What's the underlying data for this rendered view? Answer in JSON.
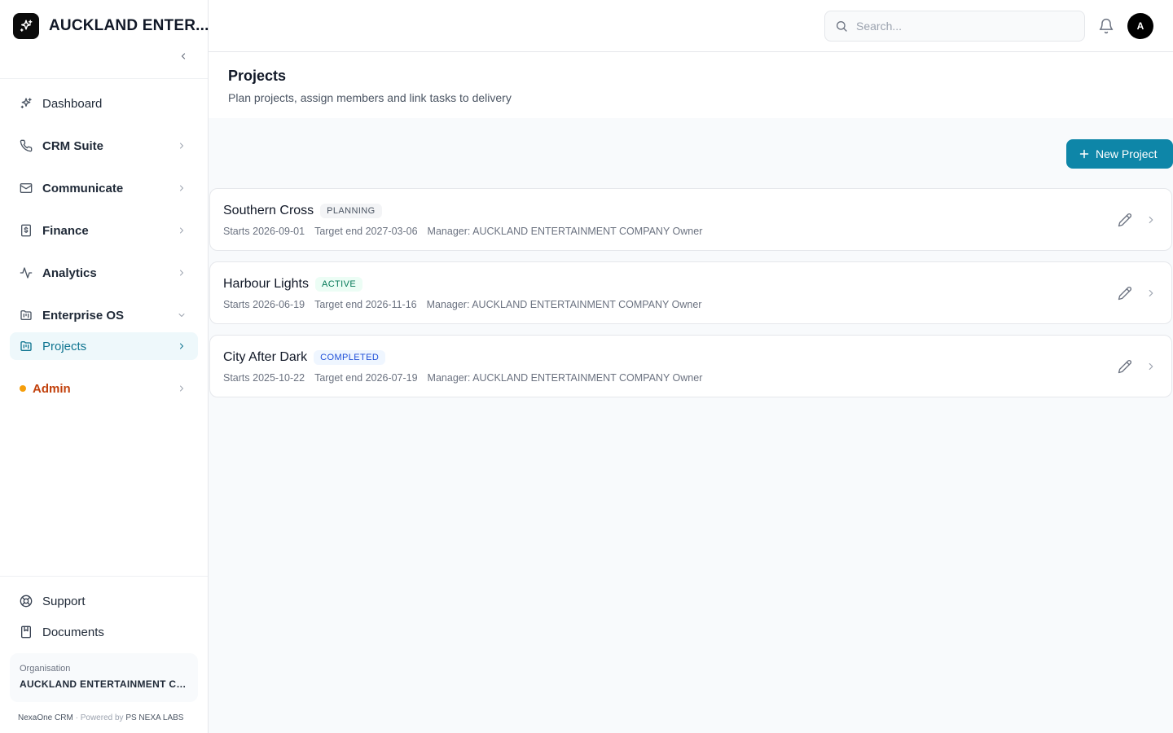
{
  "brand": {
    "name": "AUCKLAND ENTER..."
  },
  "sidebar": {
    "items": [
      {
        "label": "Dashboard",
        "icon": "sparkles-icon"
      },
      {
        "label": "CRM Suite",
        "icon": "phone-icon"
      },
      {
        "label": "Communicate",
        "icon": "mail-icon"
      },
      {
        "label": "Finance",
        "icon": "receipt-icon"
      },
      {
        "label": "Analytics",
        "icon": "activity-icon"
      },
      {
        "label": "Enterprise OS",
        "icon": "kanban-icon"
      },
      {
        "label": "Projects",
        "icon": "folder-kanban-icon"
      },
      {
        "label": "Admin",
        "icon": "status-dot"
      }
    ],
    "footer_items": [
      {
        "label": "Support",
        "icon": "life-buoy-icon"
      },
      {
        "label": "Documents",
        "icon": "book-icon"
      }
    ],
    "org": {
      "label": "Organisation",
      "name": "AUCKLAND ENTERTAINMENT CO..."
    },
    "powered": {
      "product": "NexaOne CRM",
      "separator": "·",
      "prefix": "Powered by",
      "company": "PS NEXA LABS"
    }
  },
  "topbar": {
    "search_placeholder": "Search...",
    "avatar_initial": "A"
  },
  "page": {
    "title": "Projects",
    "subtitle": "Plan projects, assign members and link tasks to delivery",
    "new_button": "New Project"
  },
  "projects": [
    {
      "name": "Southern Cross",
      "status": "PLANNING",
      "starts": "Starts 2026-09-01",
      "target": "Target end 2027-03-06",
      "manager": "Manager: AUCKLAND ENTERTAINMENT COMPANY Owner"
    },
    {
      "name": "Harbour Lights",
      "status": "ACTIVE",
      "starts": "Starts 2026-06-19",
      "target": "Target end 2026-11-16",
      "manager": "Manager: AUCKLAND ENTERTAINMENT COMPANY Owner"
    },
    {
      "name": "City After Dark",
      "status": "COMPLETED",
      "starts": "Starts 2025-10-22",
      "target": "Target end 2026-07-19",
      "manager": "Manager: AUCKLAND ENTERTAINMENT COMPANY Owner"
    }
  ],
  "colors": {
    "accent": "#0e86a8",
    "active_nav_bg": "#eef8fb",
    "admin_text": "#c2410c",
    "admin_dot": "#f59e0b"
  }
}
